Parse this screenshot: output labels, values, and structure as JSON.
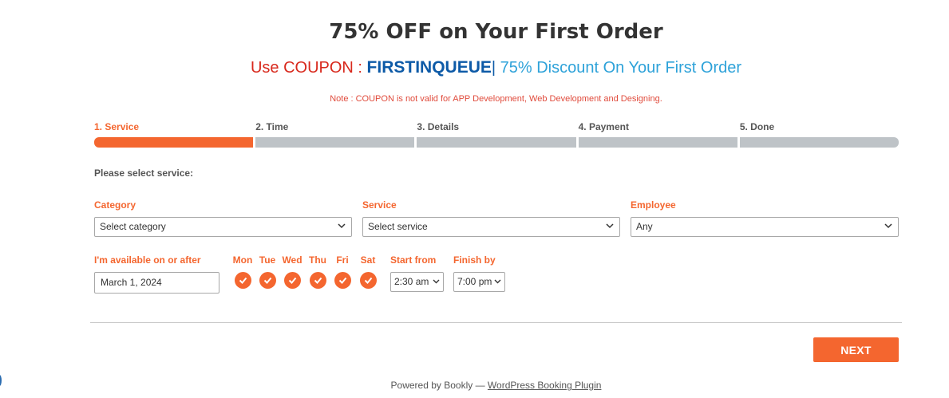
{
  "header": {
    "title": "75% OFF on Your First Order",
    "coupon_prefix": "Use COUPON : ",
    "coupon_code": "FIRSTINQUEUE",
    "coupon_separator": "|",
    "coupon_suffix": " 75% Discount On Your First Order",
    "note": "Note : COUPON is not valid for APP Development, Web Development and Designing."
  },
  "steps": [
    {
      "label": "1. Service",
      "active": true
    },
    {
      "label": "2. Time",
      "active": false
    },
    {
      "label": "3. Details",
      "active": false
    },
    {
      "label": "4. Payment",
      "active": false
    },
    {
      "label": "5. Done",
      "active": false
    }
  ],
  "form": {
    "prompt": "Please select service:",
    "category_label": "Category",
    "category_value": "Select category",
    "service_label": "Service",
    "service_value": "Select service",
    "employee_label": "Employee",
    "employee_value": "Any",
    "available_label": "I'm available on or after",
    "date_value": "March 1, 2024",
    "days": [
      {
        "label": "Mon",
        "checked": true
      },
      {
        "label": "Tue",
        "checked": true
      },
      {
        "label": "Wed",
        "checked": true
      },
      {
        "label": "Thu",
        "checked": true
      },
      {
        "label": "Fri",
        "checked": true
      },
      {
        "label": "Sat",
        "checked": true
      }
    ],
    "start_label": "Start from",
    "start_value": "2:30 am",
    "finish_label": "Finish by",
    "finish_value": "7:00 pm"
  },
  "actions": {
    "next_label": "NEXT"
  },
  "footer": {
    "prefix": "Powered by Bookly — ",
    "link_text": "WordPress Booking Plugin"
  },
  "colors": {
    "accent": "#f4662f",
    "inactive_step": "#bec3c7",
    "coupon_red": "#d8291d",
    "coupon_code": "#0d5aa7",
    "coupon_blue": "#2ea2d9"
  }
}
